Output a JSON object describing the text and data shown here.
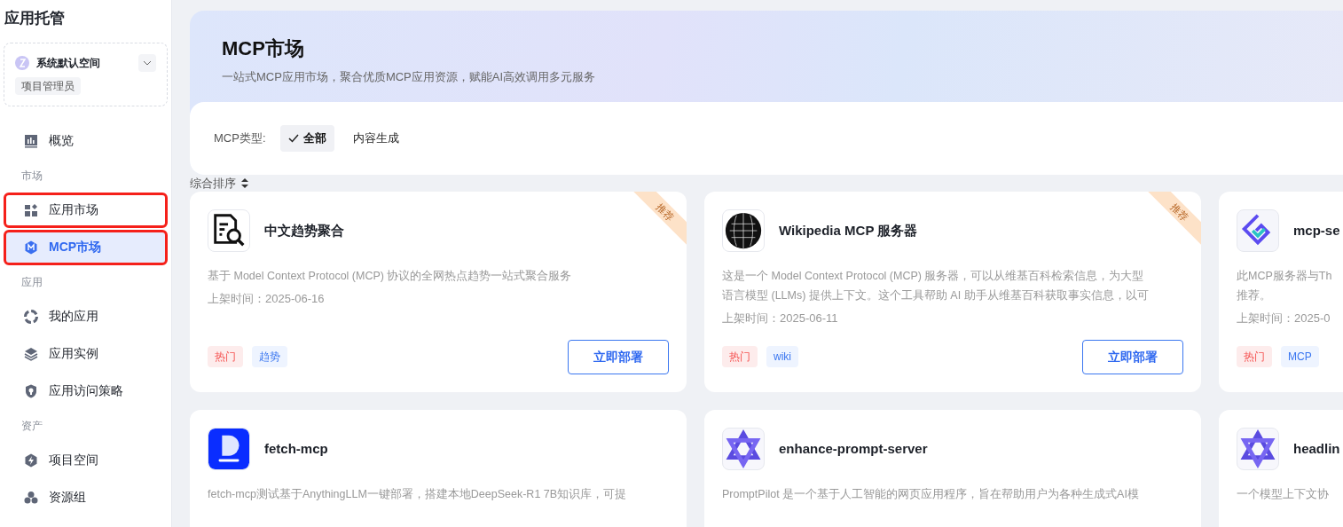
{
  "sidebar": {
    "title": "应用托管",
    "workspace": {
      "name": "系统默认空间",
      "role": "项目管理员"
    },
    "items": [
      {
        "kind": "link",
        "label": "概览",
        "selected": false,
        "outlined": false
      },
      {
        "kind": "section",
        "label": "市场"
      },
      {
        "kind": "link",
        "label": "应用市场",
        "selected": false,
        "outlined": true
      },
      {
        "kind": "link",
        "label": "MCP市场",
        "selected": true,
        "outlined": true
      },
      {
        "kind": "section",
        "label": "应用"
      },
      {
        "kind": "link",
        "label": "我的应用",
        "selected": false,
        "outlined": false
      },
      {
        "kind": "link",
        "label": "应用实例",
        "selected": false,
        "outlined": false
      },
      {
        "kind": "link",
        "label": "应用访问策略",
        "selected": false,
        "outlined": false
      },
      {
        "kind": "section",
        "label": "资产"
      },
      {
        "kind": "link",
        "label": "项目空间",
        "selected": false,
        "outlined": false
      },
      {
        "kind": "link",
        "label": "资源组",
        "selected": false,
        "outlined": false
      }
    ]
  },
  "header": {
    "title": "MCP市场",
    "subtitle": "一站式MCP应用市场，聚合优质MCP应用资源，赋能AI高效调用多元服务"
  },
  "filter": {
    "label": "MCP类型:",
    "options": [
      {
        "label": "全部",
        "selected": true
      },
      {
        "label": "内容生成",
        "selected": false
      }
    ]
  },
  "sort": {
    "label": "综合排序"
  },
  "cards": [
    {
      "kind": "doc-search",
      "title": "中文趋势聚合",
      "badge": "推荐",
      "description": [
        "基于 Model Context Protocol (MCP) 协议的全网热点趋势一站式聚合服务"
      ],
      "date": "上架时间：2025-06-16",
      "tags": [
        {
          "kind": "hot",
          "label": "热门",
          "color": "#fdecec"
        },
        {
          "kind": "topic",
          "label": "趋势",
          "color": "#eef4ff"
        }
      ],
      "button": "立即部署"
    },
    {
      "kind": "globe",
      "title": "Wikipedia MCP 服务器",
      "badge": "推荐",
      "description": [
        "这是一个 Model Context Protocol (MCP) 服务器，可以从维基百科检索信息，为大型",
        "语言模型 (LLMs) 提供上下文。这个工具帮助 AI 助手从维基百科获取事实信息，以可"
      ],
      "date": "上架时间：2025-06-11",
      "tags": [
        {
          "kind": "hot",
          "label": "热门",
          "color": "#fdecec"
        },
        {
          "kind": "topic",
          "label": "wiki",
          "color": "#eef4ff"
        }
      ],
      "button": "立即部署"
    },
    {
      "kind": "maze",
      "title": "mcp-se",
      "description": [
        "此MCP服务器与Th",
        "推荐。"
      ],
      "date": "上架时间：2025-0",
      "tags": [
        {
          "kind": "hot",
          "label": "热门",
          "color": "#fdecec"
        },
        {
          "kind": "topic",
          "label": "MCP",
          "color": "#eef4ff"
        }
      ]
    },
    {
      "kind": "dify",
      "title": "fetch-mcp",
      "description": [
        "fetch-mcp测试基于AnythingLLM一键部署，搭建本地DeepSeek-R1 7B知识库，可提"
      ]
    },
    {
      "kind": "star",
      "title": "enhance-prompt-server",
      "description": [
        "PromptPilot 是一个基于人工智能的网页应用程序，旨在帮助用户为各种生成式AI模"
      ]
    },
    {
      "kind": "star",
      "title": "headlin",
      "description": [
        "一个模型上下文协"
      ]
    }
  ]
}
